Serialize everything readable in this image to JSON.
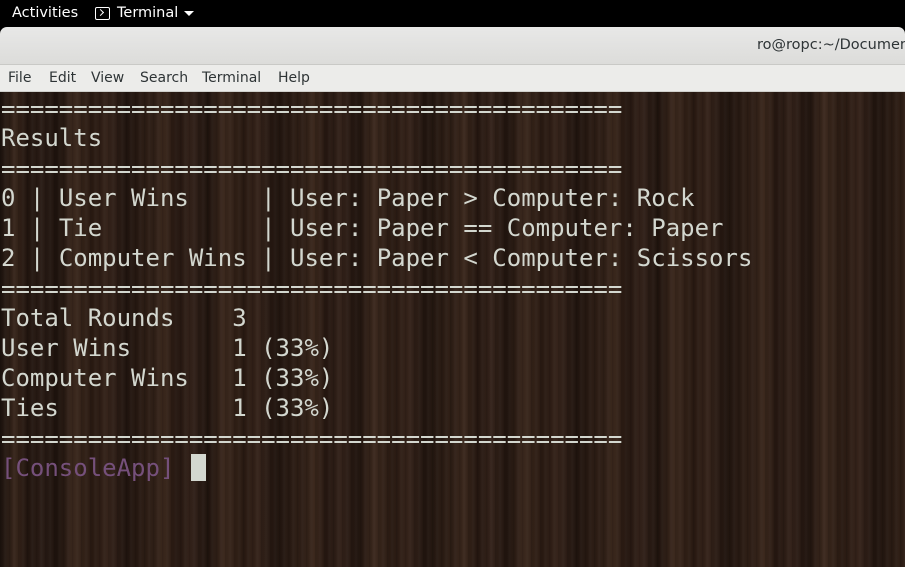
{
  "topbar": {
    "activities": "Activities",
    "app_name": "Terminal",
    "app_icon": "terminal-icon"
  },
  "window": {
    "title": "ro@ropc:~/Documents"
  },
  "menubar": {
    "items": [
      "File",
      "Edit",
      "View",
      "Search",
      "Terminal",
      "Help"
    ]
  },
  "terminal": {
    "separator": "===========================================",
    "results_heading": "Results",
    "rounds": [
      {
        "index": "0",
        "outcome": "User Wins",
        "detail": "User: Paper > Computer: Rock",
        "color": "#8ae234"
      },
      {
        "index": "1",
        "outcome": "Tie",
        "detail": "User: Paper == Computer: Paper",
        "color": "#d3d7cf"
      },
      {
        "index": "2",
        "outcome": "Computer Wins",
        "detail": "User: Paper < Computer: Scissors",
        "color": "#ef2929"
      }
    ],
    "stats": [
      {
        "label": "Total Rounds",
        "value": "3"
      },
      {
        "label": "User Wins",
        "value": "1 (33%)"
      },
      {
        "label": "Computer Wins",
        "value": "1 (33%)"
      },
      {
        "label": "Ties",
        "value": "1 (33%)"
      }
    ],
    "prompt": "[ConsoleApp]"
  }
}
